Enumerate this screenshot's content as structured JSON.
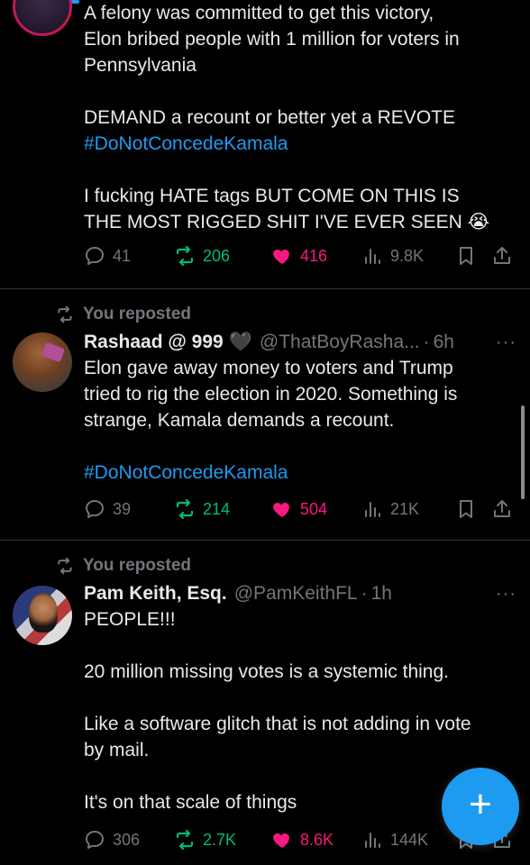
{
  "tweets": [
    {
      "text_lines": [
        "A felony was committed to get this victory,",
        "Elon bribed people with 1 million for voters in",
        "Pennsylvania"
      ],
      "text_line_2": "DEMAND a recount or better yet a REVOTE",
      "hashtag": "#DoNotConcedeKamala",
      "text_line_3a": "I fucking HATE tags BUT COME ON THIS IS",
      "text_line_3b": "THE MOST RIGGED SHIT I'VE EVER SEEN",
      "emoji": "😭",
      "replies": "41",
      "reposts": "206",
      "likes": "416",
      "views": "9.8K"
    },
    {
      "repost_label": "You reposted",
      "name": "Rashaad @ 999",
      "badge": "🖤",
      "handle": "@ThatBoyRasha...",
      "time": "6h",
      "lines": [
        "Elon gave away money to voters and Trump",
        "tried to rig the election in 2020. Something is",
        "strange, Kamala demands a recount."
      ],
      "hashtag": "#DoNotConcedeKamala",
      "replies": "39",
      "reposts": "214",
      "likes": "504",
      "views": "21K"
    },
    {
      "repost_label": "You reposted",
      "name": "Pam Keith, Esq.",
      "handle": "@PamKeithFL",
      "time": "1h",
      "line1": "PEOPLE!!!",
      "line2": "20 million missing votes is a systemic thing.",
      "line3a": "Like a software glitch that is not adding in vote",
      "line3b": "by mail.",
      "line4": "It's on that scale of things",
      "replies": "306",
      "reposts": "2.7K",
      "likes": "8.6K",
      "views": "144K"
    }
  ],
  "more_glyph": "···",
  "dot": "·",
  "fab_label": "+",
  "colors": {
    "accent": "#1d9bf0",
    "like": "#f91880",
    "repost": "#00ba7c",
    "muted": "#71767b"
  },
  "icons": [
    "reply-icon",
    "repost-icon",
    "heart-icon",
    "views-icon",
    "bookmark-icon",
    "share-icon",
    "compose-plus-icon"
  ]
}
